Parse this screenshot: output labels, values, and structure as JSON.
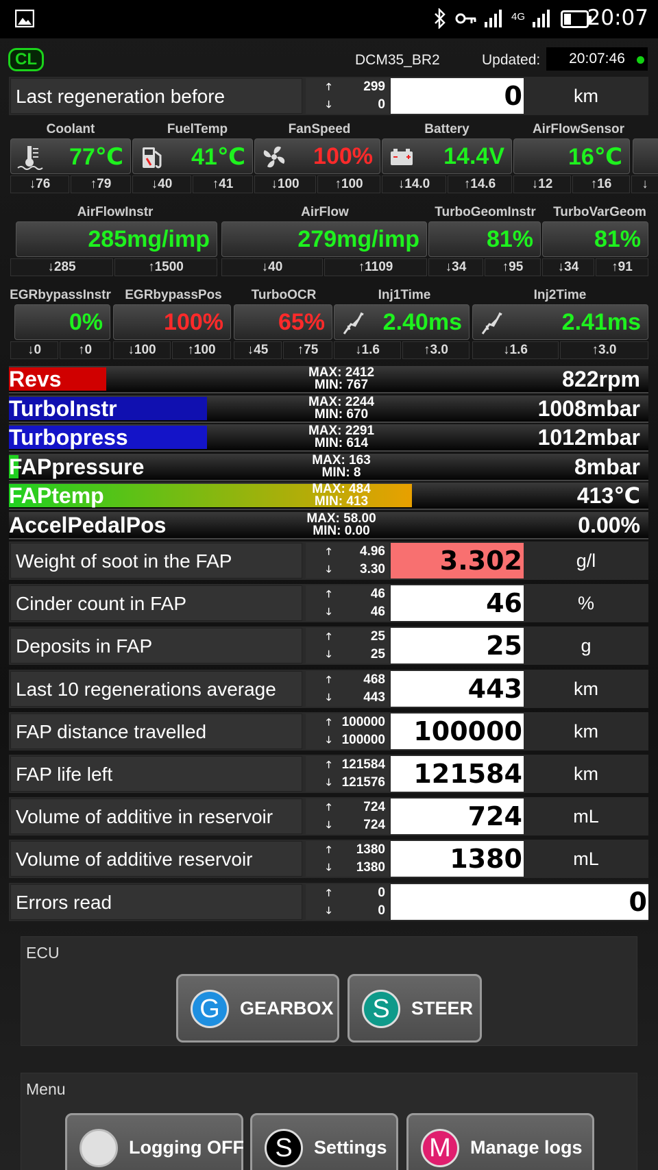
{
  "status_bar": {
    "time": "20:07",
    "network": "4G"
  },
  "header": {
    "mode_badge": "CL",
    "ecu_name": "DCM35_BR2",
    "updated_label": "Updated:",
    "updated_time": "20:07:46"
  },
  "top_row": {
    "label": "Last regeneration before",
    "max": "299",
    "min": "0",
    "value": "0",
    "unit": "km"
  },
  "gauges_row1": [
    {
      "name": "Coolant",
      "value": "77℃",
      "min": "76",
      "max": "79",
      "color": "green",
      "icon": "coolant-temp-icon"
    },
    {
      "name": "FuelTemp",
      "value": "41℃",
      "min": "40",
      "max": "41",
      "color": "green",
      "icon": "fuel-pump-icon"
    },
    {
      "name": "FanSpeed",
      "value": "100%",
      "min": "100",
      "max": "100",
      "color": "red",
      "icon": "fan-icon"
    },
    {
      "name": "Battery",
      "value": "14.4V",
      "min": "14.0",
      "max": "14.6",
      "color": "green",
      "icon": "battery-icon"
    },
    {
      "name": "AirFlowSensor",
      "value": "16℃",
      "min": "12",
      "max": "16",
      "color": "green",
      "icon": ""
    }
  ],
  "gauges_row2": [
    {
      "name": "AirFlowInstr",
      "value": "285mg/imp",
      "min": "285",
      "max": "1500",
      "color": "green"
    },
    {
      "name": "AirFlow",
      "value": "279mg/imp",
      "min": "40",
      "max": "1109",
      "color": "green"
    },
    {
      "name": "TurboGeomInstr",
      "value": "81%",
      "min": "34",
      "max": "95",
      "color": "green"
    },
    {
      "name": "TurboVarGeom",
      "value": "81%",
      "min": "34",
      "max": "91",
      "color": "green"
    }
  ],
  "gauges_row3": [
    {
      "name": "EGRbypassInstr",
      "value": "0%",
      "min": "0",
      "max": "0",
      "color": "green"
    },
    {
      "name": "EGRbypassPos",
      "value": "100%",
      "min": "100",
      "max": "100",
      "color": "red"
    },
    {
      "name": "TurboOCR",
      "value": "65%",
      "min": "45",
      "max": "75",
      "color": "red"
    },
    {
      "name": "Inj1Time",
      "value": "2.40ms",
      "min": "1.6",
      "max": "3.0",
      "color": "green",
      "icon": "injector-icon"
    },
    {
      "name": "Inj2Time",
      "value": "2.41ms",
      "min": "1.6",
      "max": "3.0",
      "color": "green",
      "icon": "injector-icon"
    }
  ],
  "bars": [
    {
      "name": "Revs",
      "max": "MAX: 2412",
      "min": "MIN: 767",
      "value": "822rpm",
      "fill_fraction": 0.152,
      "color": "#d00000"
    },
    {
      "name": "TurboInstr",
      "max": "MAX: 2244",
      "min": "MIN: 670",
      "value": "1008mbar",
      "fill_fraction": 0.31,
      "color": "#1010b0"
    },
    {
      "name": "Turbopress",
      "max": "MAX: 2291",
      "min": "MIN: 614",
      "value": "1012mbar",
      "fill_fraction": 0.31,
      "color": "#1414c8"
    },
    {
      "name": "FAPpressure",
      "max": "MAX: 163",
      "min": "MIN: 8",
      "value": "8mbar",
      "fill_fraction": 0.015,
      "color": "#20d020"
    },
    {
      "name": "FAPtemp",
      "max": "MAX: 484",
      "min": "MIN: 413",
      "value": "413℃",
      "fill_fraction": 0.63,
      "color": "gradient"
    },
    {
      "name": "AccelPedalPos",
      "max": "MAX: 58.00",
      "min": "MIN: 0.00",
      "value": "0.00%",
      "fill_fraction": 0,
      "color": "#20d020"
    }
  ],
  "fap_rows": [
    {
      "label": "Weight of soot in the FAP",
      "max": "4.96",
      "min": "3.30",
      "value": "3.302",
      "unit": "g/l",
      "highlight": "#f87070"
    },
    {
      "label": "Cinder count in FAP",
      "max": "46",
      "min": "46",
      "value": "46",
      "unit": "%"
    },
    {
      "label": "Deposits in FAP",
      "max": "25",
      "min": "25",
      "value": "25",
      "unit": "g"
    },
    {
      "label": "Last 10 regenerations average",
      "max": "468",
      "min": "443",
      "value": "443",
      "unit": "km"
    },
    {
      "label": "FAP distance travelled",
      "max": "100000",
      "min": "100000",
      "value": "100000",
      "unit": "km"
    },
    {
      "label": "FAP life left",
      "max": "121584",
      "min": "121576",
      "value": "121584",
      "unit": "km"
    },
    {
      "label": "Volume of additive in reservoir",
      "max": "724",
      "min": "724",
      "value": "724",
      "unit": "mL"
    },
    {
      "label": "Volume of additive reservoir",
      "max": "1380",
      "min": "1380",
      "value": "1380",
      "unit": "mL"
    },
    {
      "label": "Errors read",
      "max": "0",
      "min": "0",
      "value": "0",
      "unit": ""
    }
  ],
  "ecu_panel": {
    "title": "ECU",
    "buttons": [
      {
        "letter": "G",
        "label": "GEARBOX",
        "color": "#1e8fe0"
      },
      {
        "letter": "S",
        "label": "STEER",
        "color": "#0f9a8a"
      }
    ]
  },
  "menu_panel": {
    "title": "Menu",
    "buttons": [
      {
        "letter": "",
        "label": "Logging OFF",
        "color": "#e0e0e0"
      },
      {
        "letter": "S",
        "label": "Settings",
        "color": "#000000"
      },
      {
        "letter": "M",
        "label": "Manage logs",
        "color": "#e01e6e"
      }
    ]
  }
}
